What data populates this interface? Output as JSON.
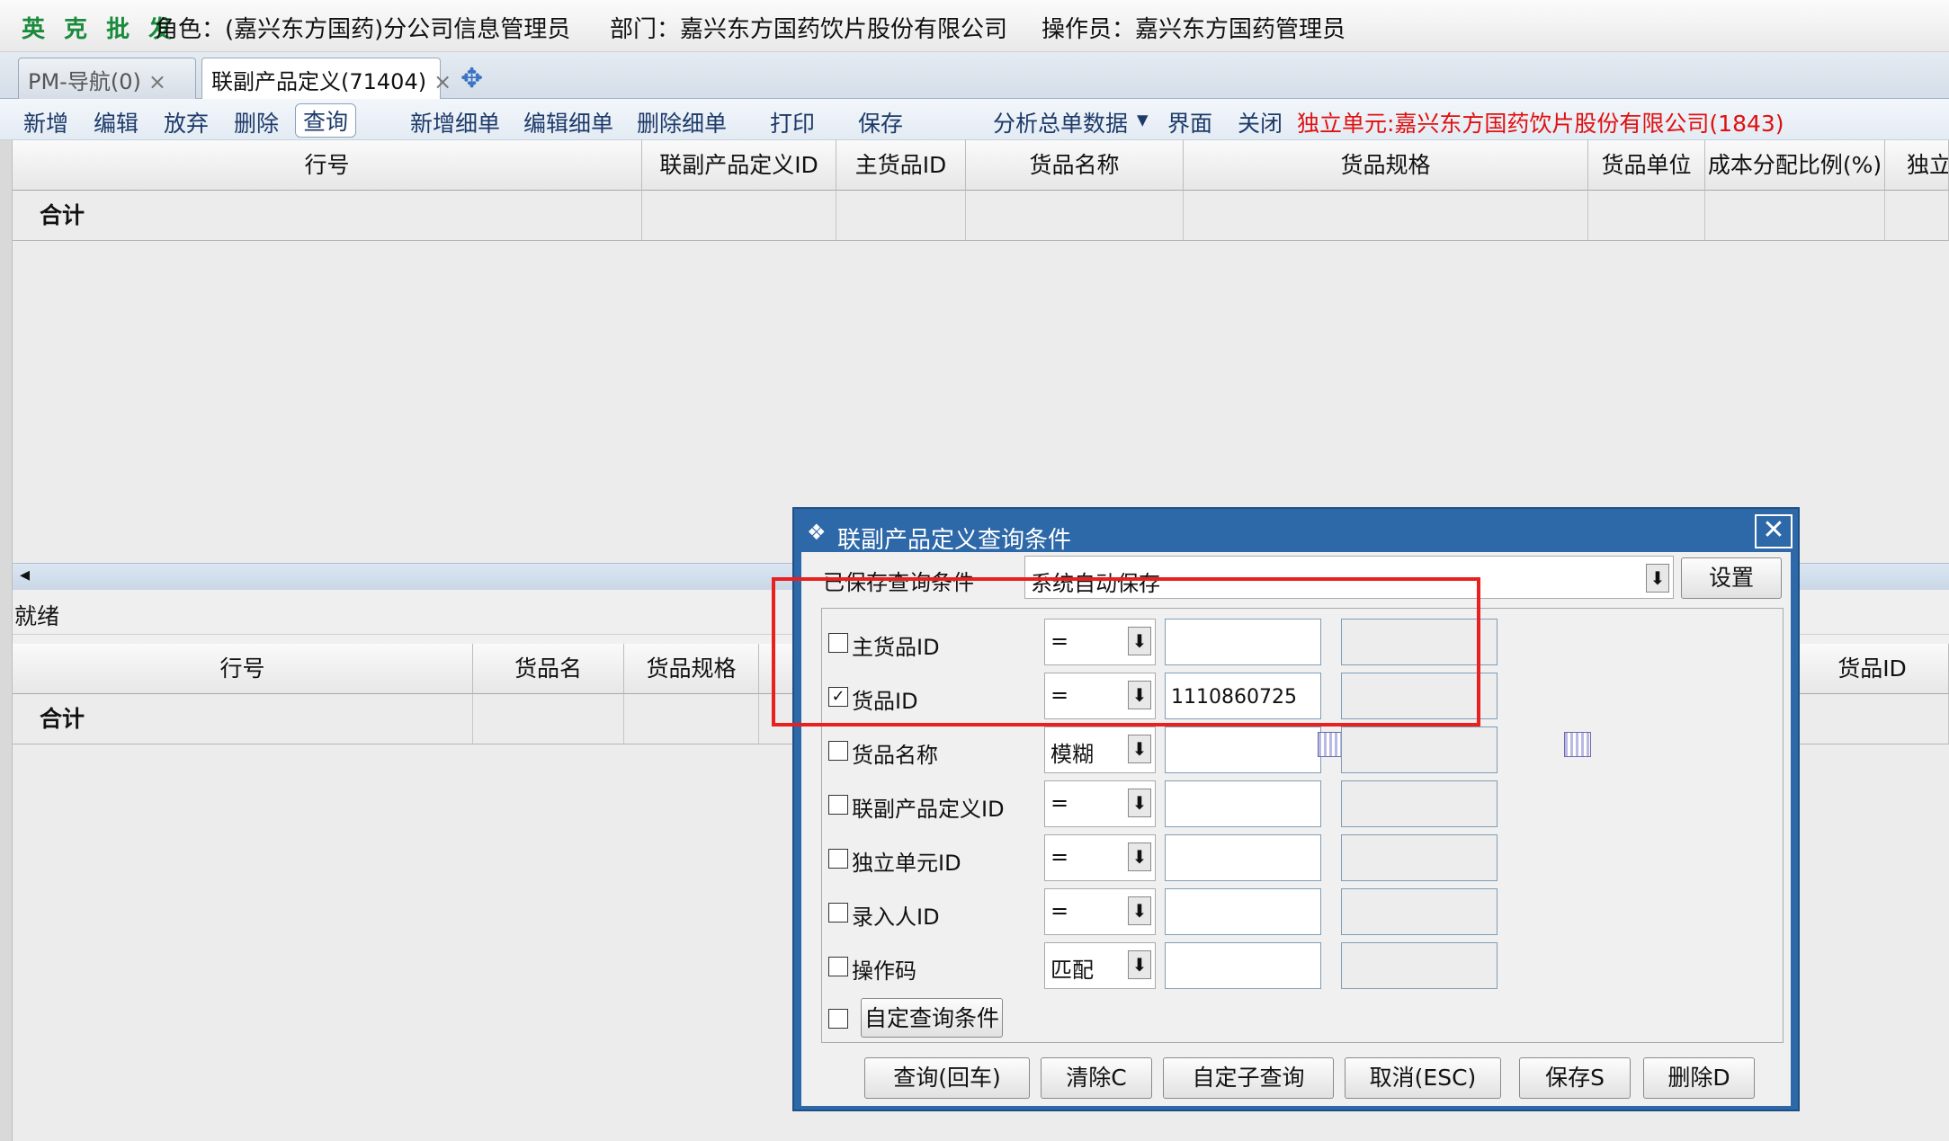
{
  "app": {
    "brand": "英 克 批 发",
    "role": "角色：(嘉兴东方国药)分公司信息管理员",
    "dept": "部门：嘉兴东方国药饮片股份有限公司",
    "operator": "操作员：嘉兴东方国药管理员"
  },
  "tabs": [
    {
      "label": "PM-导航(0)",
      "close": "×"
    },
    {
      "label": "联副产品定义(71404)",
      "close": "×"
    }
  ],
  "toolbar": {
    "new": "新增",
    "edit": "编辑",
    "discard": "放弃",
    "delete": "删除",
    "query": "查询",
    "add_detail": "新增细单",
    "edit_detail": "编辑细单",
    "delete_detail": "删除细单",
    "print": "打印",
    "save": "保存",
    "analyze": "分析总单数据",
    "analyze_arrow": "▾",
    "ui": "界面",
    "close": "关闭",
    "unit": "独立单元:嘉兴东方国药饮片股份有限公司(1843)",
    "unit_color": "#e01010"
  },
  "top_grid": {
    "columns": [
      "行号",
      "联副产品定义ID",
      "主货品ID",
      "货品名称",
      "货品规格",
      "货品单位",
      "成本分配比例(%)",
      "独立"
    ],
    "summary": "合计"
  },
  "status": {
    "text": "就绪",
    "scroll_left": "◂"
  },
  "bottom_grid": {
    "columns": [
      "行号",
      "货品名",
      "货品规格",
      "货品ID"
    ],
    "summary": "合计"
  },
  "dialog": {
    "title": "联副产品定义查询条件",
    "close": "✕",
    "saved_label": "已保存查询条件",
    "saved_value": "系统自动保存",
    "settings": "设置",
    "rows": [
      {
        "label": "主货品ID",
        "checked": false,
        "op": "=",
        "value": ""
      },
      {
        "label": "货品ID",
        "checked": true,
        "op": "=",
        "value": "1110860725"
      },
      {
        "label": "货品名称",
        "checked": false,
        "op": "模糊",
        "value": ""
      },
      {
        "label": "联副产品定义ID",
        "checked": false,
        "op": "=",
        "value": ""
      },
      {
        "label": "独立单元ID",
        "checked": false,
        "op": "=",
        "value": ""
      },
      {
        "label": "录入人ID",
        "checked": false,
        "op": "=",
        "value": ""
      },
      {
        "label": "操作码",
        "checked": false,
        "op": "匹配",
        "value": ""
      }
    ],
    "custom_label": "自定查询条件",
    "buttons": [
      "查询(回车)",
      "清除C",
      "自定子查询",
      "取消(ESC)",
      "保存S",
      "删除D"
    ],
    "check_mark": "✓",
    "arrow": "⬇"
  },
  "colors": {
    "highlight_box": "#e82020",
    "brand": "#1a8a3c",
    "dialog_frame": "#2d68a8"
  }
}
